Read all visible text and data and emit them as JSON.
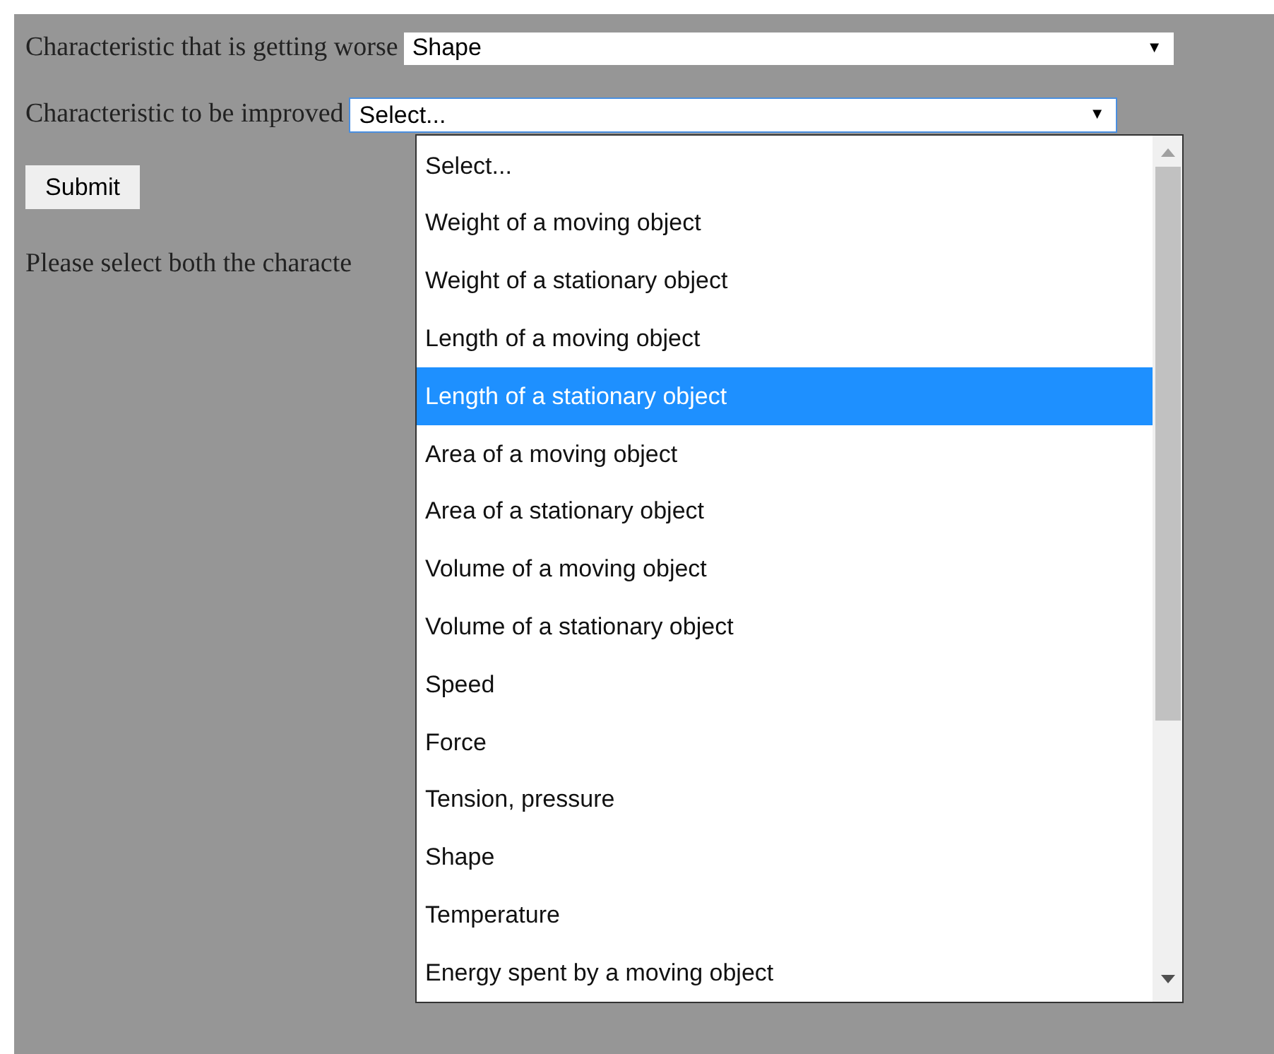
{
  "worse_field": {
    "label": "Characteristic that is getting worse",
    "value": "Shape",
    "arrow": "▼"
  },
  "improve_field": {
    "label": "Characteristic to be improved",
    "value": "Select...",
    "arrow": "▼",
    "focused": true,
    "expanded": true
  },
  "submit_button": {
    "label": "Submit"
  },
  "message": "Please select both the characte",
  "dropdown": {
    "options": [
      {
        "label": "Select...",
        "selected": false
      },
      {
        "label": "Weight of a moving object",
        "selected": false
      },
      {
        "label": "Weight of a stationary object",
        "selected": false
      },
      {
        "label": "Length of a moving object",
        "selected": false
      },
      {
        "label": "Length of a stationary object",
        "selected": true
      },
      {
        "label": "Area of a moving object",
        "selected": false
      },
      {
        "label": "Area of a stationary object",
        "selected": false
      },
      {
        "label": "Volume of a moving object",
        "selected": false
      },
      {
        "label": "Volume of a stationary object",
        "selected": false
      },
      {
        "label": "Speed",
        "selected": false
      },
      {
        "label": "Force",
        "selected": false
      },
      {
        "label": "Tension, pressure",
        "selected": false
      },
      {
        "label": "Shape",
        "selected": false
      },
      {
        "label": "Temperature",
        "selected": false
      },
      {
        "label": "Energy spent by a moving object",
        "selected": false
      }
    ]
  }
}
